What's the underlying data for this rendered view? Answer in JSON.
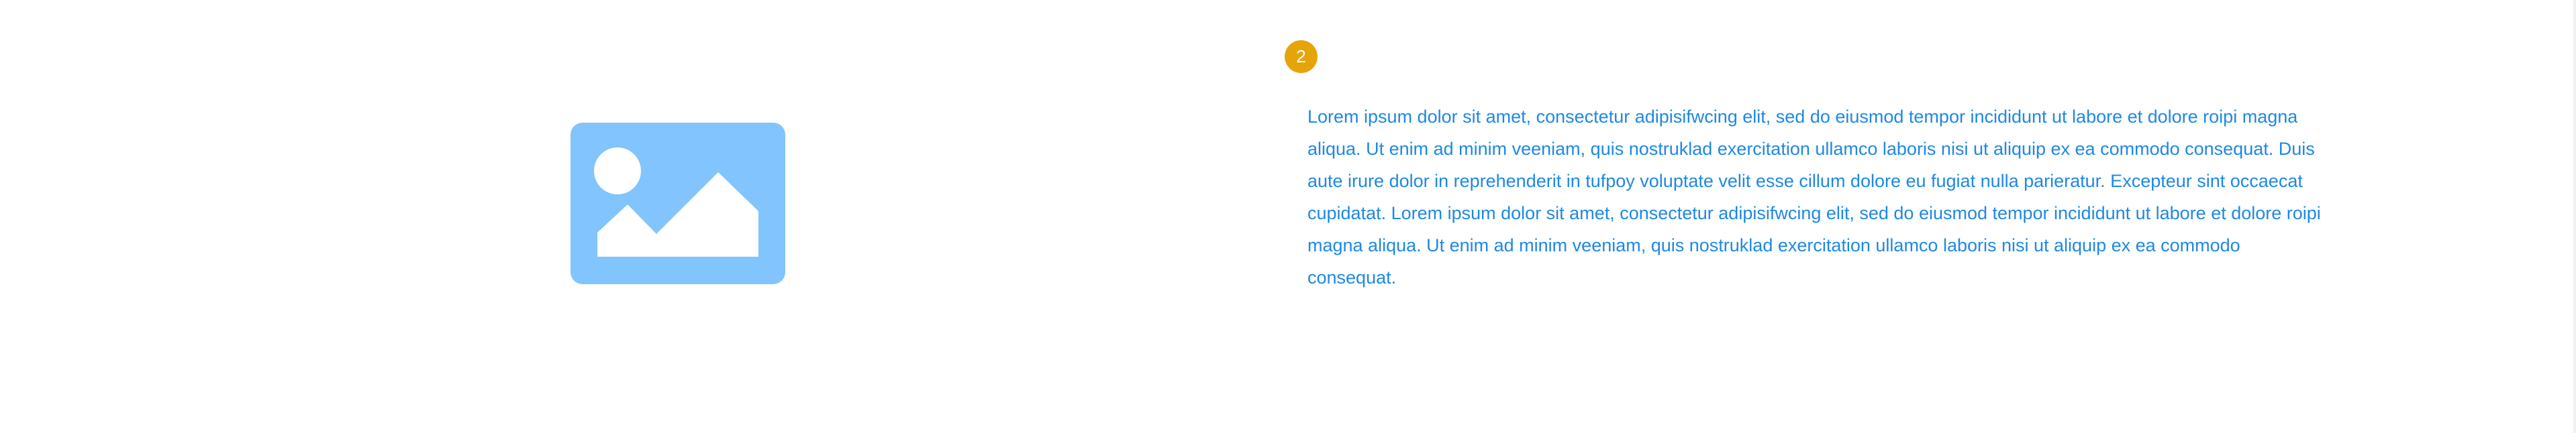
{
  "step": {
    "number": "2",
    "badge_color": "#E5A50A"
  },
  "image": {
    "icon": "image-placeholder-icon",
    "color": "#82C4FD"
  },
  "content": {
    "text_color": "#1E88E5",
    "paragraph": "Lorem ipsum dolor sit amet, consectetur adipisifwcing elit, sed do eiusmod tempor incididunt ut labore et dolore roipi magna aliqua. Ut enim ad minim veeniam, quis nostruklad exercitation ullamco laboris nisi ut aliquip ex ea commodo consequat. Duis aute irure dolor in reprehenderit in tufpoy voluptate velit esse cillum dolore eu fugiat nulla parieratur. Excepteur sint occaecat cupidatat. Lorem ipsum dolor sit amet, consectetur adipisifwcing elit, sed do eiusmod tempor incididunt ut labore et dolore roipi magna aliqua. Ut enim ad minim veeniam, quis nostruklad exercitation ullamco laboris nisi ut aliquip ex ea commodo consequat."
  }
}
